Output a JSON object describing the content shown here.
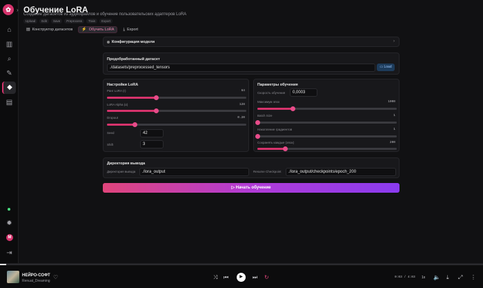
{
  "app": {
    "logo_glyph": "✿",
    "collapse_glyph": "›",
    "brand_color": "#d6336c",
    "avatar_letter": "M"
  },
  "sidebar_icons": [
    "home-icon",
    "library-icon",
    "search-icon",
    "tools-icon",
    "training-icon",
    "datasets-icon",
    "settings-icon",
    "logout-icon"
  ],
  "header": {
    "title": "Обучение LoRA",
    "subtitle": "Создание датасетов из аудиофайлов и обучение пользовательских адаптеров LoRA",
    "chips": [
      "Upload",
      "Edit",
      "Save",
      "Preprocess",
      "Train",
      "Export"
    ]
  },
  "tabs": [
    {
      "label": "Конструктор датасетов",
      "icon": "▤"
    },
    {
      "label": "Обучить LoRA",
      "icon": "⚡"
    },
    {
      "label": "Export",
      "icon": "⤓"
    }
  ],
  "config": {
    "title": "Конфигурация модели",
    "chevron": "›"
  },
  "dataset": {
    "title": "Предобработанный датасет",
    "path": "./datasets/preprocessed_tensors",
    "load_label": "Load"
  },
  "lora": {
    "title": "Настройки LoRA",
    "rank_label": "Ранг LoRA (r)",
    "rank_value": "64",
    "rank_fraction": 0.35,
    "alpha_label": "LoRA Alpha (α)",
    "alpha_value": "128",
    "alpha_fraction": 0.35,
    "dropout_label": "Dropout",
    "dropout_value": "0.20",
    "dropout_fraction": 0.2,
    "seed_label": "Seed",
    "seed_value": "42",
    "shift_label": "Shift",
    "shift_value": "3"
  },
  "train": {
    "title": "Параметры обучения",
    "lr_label": "Скорость обучения",
    "lr_value": "0,0003",
    "epochs_label": "Максимум эпох",
    "epochs_value": "1000",
    "epochs_fraction": 0.25,
    "batch_label": "Batch Size",
    "batch_value": "1",
    "batch_fraction": 0.0,
    "grad_label": "Накопление градиентов",
    "grad_value": "1",
    "grad_fraction": 0.0,
    "save_label": "Сохранять каждые (эпох)",
    "save_value": "200",
    "save_fraction": 0.2
  },
  "output": {
    "title": "Директория вывода",
    "dir_label": "Директория вывода",
    "dir_value": "./lora_output",
    "ckpt_label": "Resume Checkpoint",
    "ckpt_value": "./lora_output/checkpoints/epoch_200"
  },
  "start_button": {
    "label": "Начать обучение",
    "icon": "▷"
  },
  "player": {
    "track": "НЕЙРО-СОФТ",
    "artist": "Renuat_Dreaming",
    "time": "0:03 / 4:03",
    "progress_fraction": 0.013,
    "speed": "1x"
  }
}
